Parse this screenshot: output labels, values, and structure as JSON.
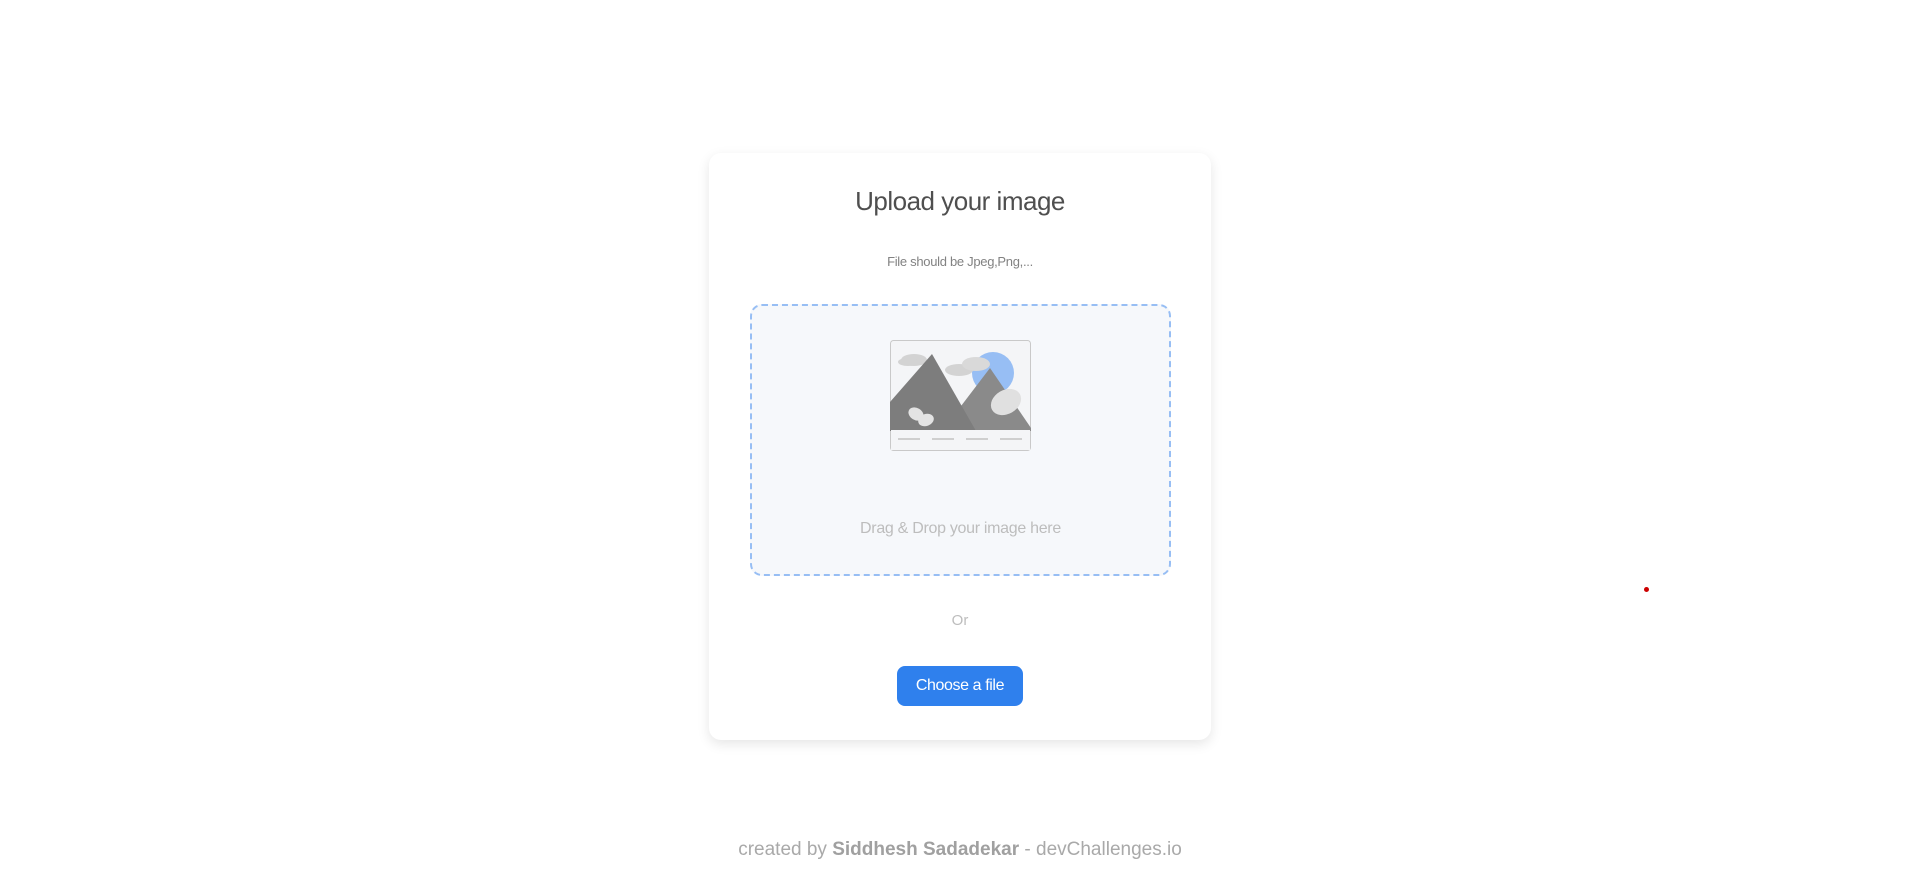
{
  "card": {
    "title": "Upload your image",
    "subtitle": "File should be Jpeg,Png,...",
    "dropzone": {
      "icon": "image-placeholder-icon",
      "text": "Drag & Drop your image here"
    },
    "separator": "Or",
    "choose_button_label": "Choose a file"
  },
  "footer": {
    "prefix": "created by",
    "author": "Siddhesh Sadadekar",
    "suffix": "- devChallenges.io"
  },
  "colors": {
    "accent": "#2f80ed",
    "dropzone_bg": "#f6f8fb",
    "dropzone_border": "#97bef4",
    "title": "#4f4f4f",
    "muted": "#bdbdbd"
  }
}
